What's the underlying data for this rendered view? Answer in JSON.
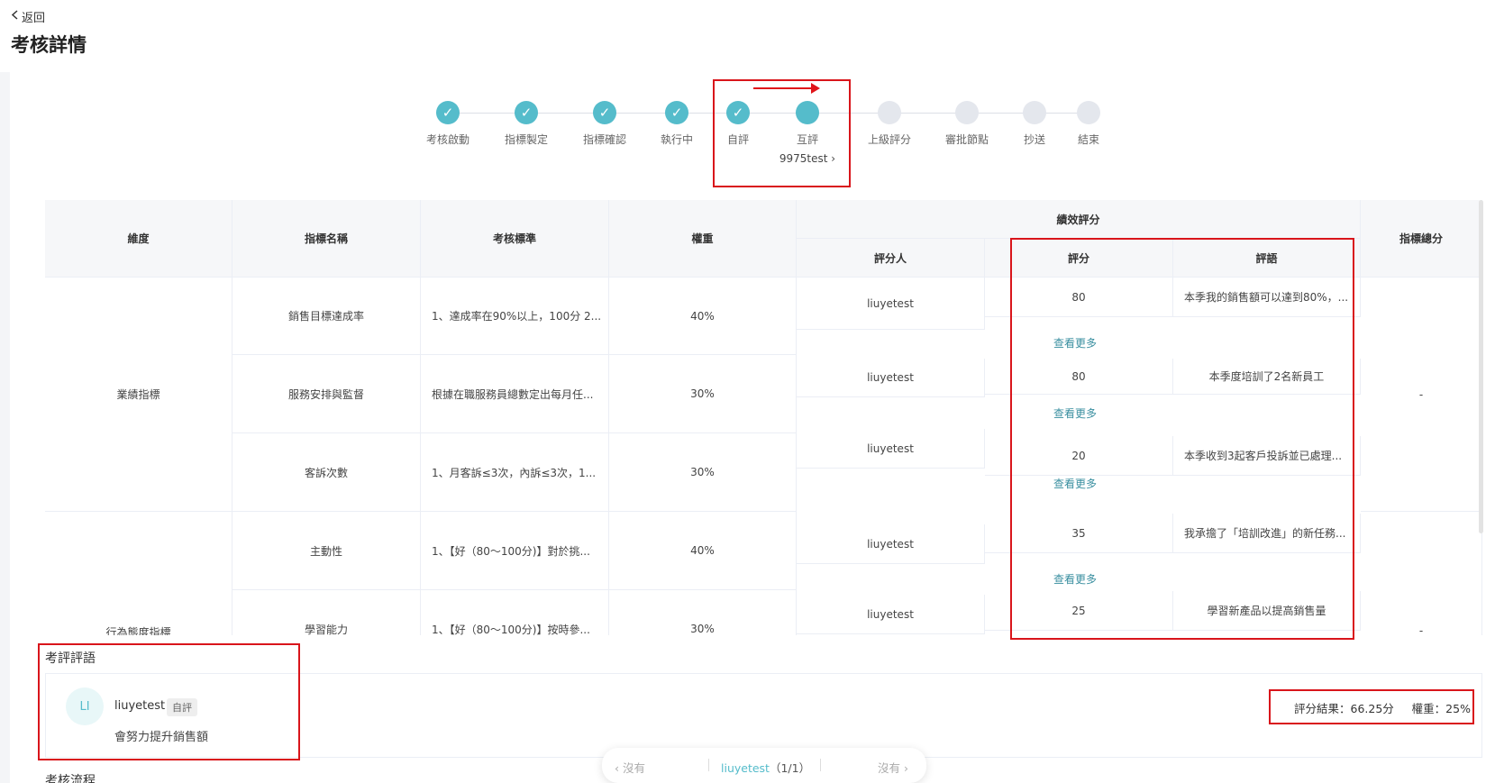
{
  "header": {
    "back_label": "返回",
    "title": "考核詳情"
  },
  "stepper": {
    "steps": [
      {
        "label": "考核啟動",
        "state": "done"
      },
      {
        "label": "指標製定",
        "state": "done"
      },
      {
        "label": "指標確認",
        "state": "done"
      },
      {
        "label": "執行中",
        "state": "done"
      },
      {
        "label": "自評",
        "state": "done"
      },
      {
        "label": "互評",
        "state": "current",
        "sub": "9975test"
      },
      {
        "label": "上級評分",
        "state": "todo"
      },
      {
        "label": "審批節點",
        "state": "todo"
      },
      {
        "label": "抄送",
        "state": "todo"
      },
      {
        "label": "結束",
        "state": "todo"
      }
    ]
  },
  "table": {
    "headers": {
      "dimension": "維度",
      "indicator_name": "指標名稱",
      "criteria": "考核標準",
      "weight": "權重",
      "performance_group": "績效評分",
      "rater": "評分人",
      "score": "評分",
      "comment": "評語",
      "total": "指標總分"
    },
    "dimensions": [
      {
        "name": "業績指標",
        "total": "-"
      },
      {
        "name": "行為態度指標",
        "total": "-"
      }
    ],
    "rows": [
      {
        "name": "銷售目標達成率",
        "criteria": "1、達成率在90%以上，100分 2...",
        "weight": "40%",
        "rater": "liuyetest",
        "score": "80",
        "comment": "本季我的銷售額可以達到80%，..."
      },
      {
        "name": "服務安排與監督",
        "criteria": "根據在職服務員總數定出每月任...",
        "weight": "30%",
        "rater": "liuyetest",
        "score": "80",
        "comment": "本季度培訓了2名新員工"
      },
      {
        "name": "客訴次數",
        "criteria": "1、月客訴≤3次，內訴≤3次，1...",
        "weight": "30%",
        "rater": "liuyetest",
        "score": "20",
        "comment": "本季收到3起客戶投訴並已處理..."
      },
      {
        "name": "主動性",
        "criteria": "1、【好（80～100分)】對於挑...",
        "weight": "40%",
        "rater": "liuyetest",
        "score": "35",
        "comment": "我承擔了「培訓改進」的新任務..."
      },
      {
        "name": "學習能力",
        "criteria": "1、【好（80～100分)】按時參...",
        "weight": "30%",
        "rater": "liuyetest",
        "score": "25",
        "comment": "學習新產品以提高銷售量"
      }
    ],
    "view_more_label": "查看更多"
  },
  "comments": {
    "title": "考評評語",
    "author_initials": "LI",
    "author": "liuyetest",
    "badge": "自評",
    "text": "會努力提升銷售額",
    "result": "評分結果：66.25分",
    "weight": "權重：25%"
  },
  "pager": {
    "prev": "沒有",
    "current_user": "liuyetest",
    "count": "（1/1）",
    "next": "沒有"
  },
  "flow_title": "考核流程",
  "colors": {
    "accent": "#55bccb",
    "highlight": "#d9151b",
    "link": "#3a8fa0"
  }
}
